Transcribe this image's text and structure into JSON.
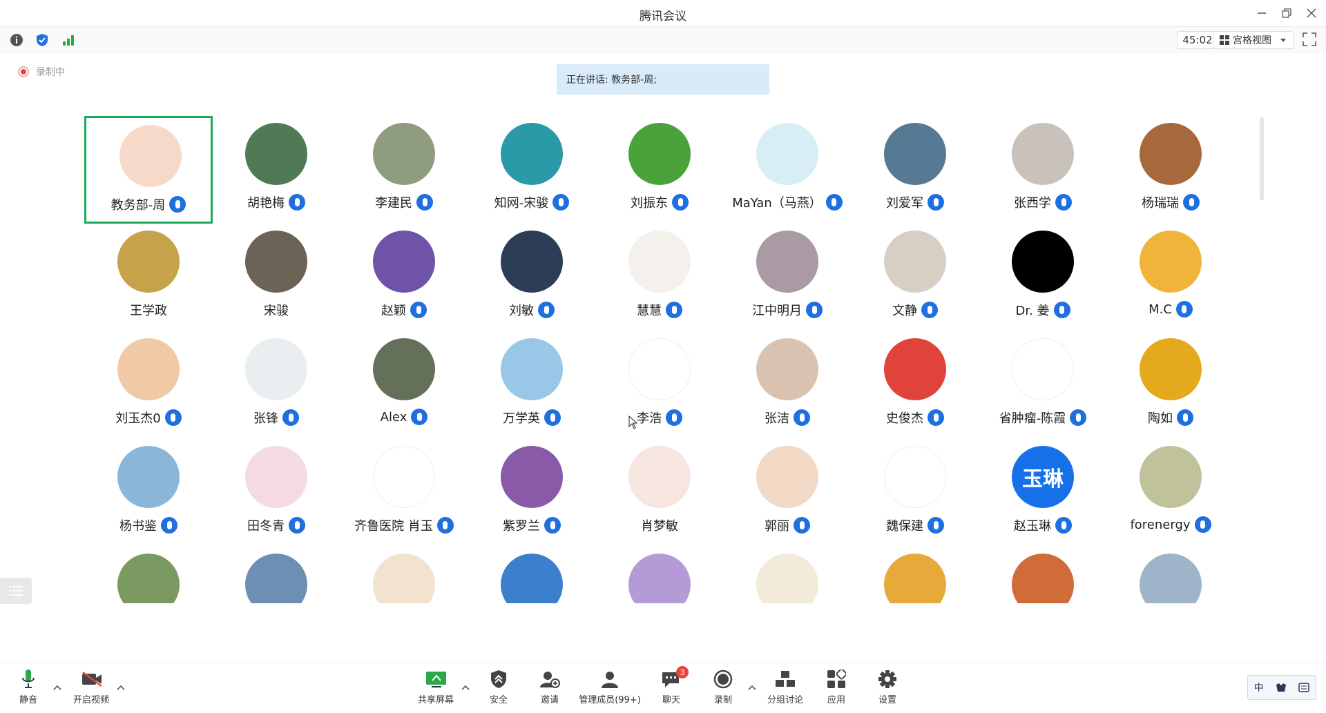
{
  "window": {
    "title": "腾讯会议"
  },
  "toolbar": {
    "timer": "45:02",
    "view_label": "宫格视图"
  },
  "status": {
    "recording_label": "录制中",
    "speaking": "正在讲话: 教务部-周;"
  },
  "colors": {
    "accent": "#1e6fe0",
    "active_border": "#1aaa5b",
    "recording": "#e8453c",
    "speaking_bg": "#d9eaf8"
  },
  "participants": [
    {
      "name": "教务部-周",
      "mic": true,
      "bg": "#f6d9c8",
      "active": true
    },
    {
      "name": "胡艳梅",
      "mic": true,
      "bg": "#4f7a55"
    },
    {
      "name": "李建民",
      "mic": true,
      "bg": "#8f9c7f"
    },
    {
      "name": "知网-宋骏",
      "mic": true,
      "bg": "#2a9aa8"
    },
    {
      "name": "刘振东",
      "mic": true,
      "bg": "#4aa33a"
    },
    {
      "name": "MaYan（马燕）",
      "mic": true,
      "bg": "#d7eef4"
    },
    {
      "name": "刘爱军",
      "mic": true,
      "bg": "#577a94"
    },
    {
      "name": "张西学",
      "mic": true,
      "bg": "#c9c2ba"
    },
    {
      "name": "杨瑞瑞",
      "mic": true,
      "bg": "#a7693c"
    },
    {
      "name": "王学政",
      "mic": false,
      "bg": "#c6a24a"
    },
    {
      "name": "宋骏",
      "mic": false,
      "bg": "#6d6256"
    },
    {
      "name": "赵颖",
      "mic": true,
      "bg": "#6e53a8"
    },
    {
      "name": "刘敏",
      "mic": true,
      "bg": "#2c3d55"
    },
    {
      "name": "慧慧",
      "mic": true,
      "bg": "#f4f1ec"
    },
    {
      "name": "江中明月",
      "mic": true,
      "bg": "#a99aa3"
    },
    {
      "name": "文静",
      "mic": true,
      "bg": "#d8cfc4"
    },
    {
      "name": "Dr. 姜",
      "mic": true,
      "bg": "#000000"
    },
    {
      "name": "M.C",
      "mic": true,
      "bg": "#f1b43b"
    },
    {
      "name": "刘玉杰0",
      "mic": true,
      "bg": "#f0c9a6"
    },
    {
      "name": "张锋",
      "mic": true,
      "bg": "#e9eef0"
    },
    {
      "name": "Alex",
      "mic": true,
      "bg": "#65705a"
    },
    {
      "name": "万学英",
      "mic": true,
      "bg": "#98c7e8"
    },
    {
      "name": "李浩",
      "mic": true,
      "bg": "#ffffff"
    },
    {
      "name": "张洁",
      "mic": true,
      "bg": "#d9c3b0"
    },
    {
      "name": "史俊杰",
      "mic": true,
      "bg": "#e0433a"
    },
    {
      "name": "省肿瘤-陈霞",
      "mic": true,
      "bg": "#ffffff"
    },
    {
      "name": "陶如",
      "mic": true,
      "bg": "#e4a91c"
    },
    {
      "name": "杨书鉴",
      "mic": true,
      "bg": "#8ab6d9"
    },
    {
      "name": "田冬青",
      "mic": true,
      "bg": "#f4dbe3"
    },
    {
      "name": "齐鲁医院 肖玉",
      "mic": true,
      "bg": "#ffffff"
    },
    {
      "name": "紫罗兰",
      "mic": true,
      "bg": "#8a5aa8"
    },
    {
      "name": "肖梦敏",
      "mic": false,
      "bg": "#f7e6df"
    },
    {
      "name": "郭丽",
      "mic": true,
      "bg": "#f2d9c6"
    },
    {
      "name": "魏保建",
      "mic": true,
      "bg": "#ffffff"
    },
    {
      "name": "赵玉琳",
      "mic": true,
      "bg": "#1670e8",
      "initials": "玉琳"
    },
    {
      "name": "forenergy",
      "mic": true,
      "bg": "#bfc29a"
    },
    {
      "name": "",
      "mic": false,
      "bg": "#7b9a62"
    },
    {
      "name": "",
      "mic": false,
      "bg": "#6d8fb3"
    },
    {
      "name": "",
      "mic": false,
      "bg": "#f3e2cf"
    },
    {
      "name": "",
      "mic": false,
      "bg": "#3c7fcc"
    },
    {
      "name": "",
      "mic": false,
      "bg": "#b49ad6"
    },
    {
      "name": "",
      "mic": false,
      "bg": "#f2ebd9"
    },
    {
      "name": "",
      "mic": false,
      "bg": "#e6a93a"
    },
    {
      "name": "",
      "mic": false,
      "bg": "#d06b3a"
    },
    {
      "name": "",
      "mic": false,
      "bg": "#9fb4c8"
    }
  ],
  "bottom": {
    "mute": "静音",
    "video": "开启视频",
    "share": "共享屏幕",
    "security": "安全",
    "invite": "邀请",
    "members": "管理成员(99+)",
    "chat": "聊天",
    "chat_badge": "3",
    "record": "录制",
    "breakout": "分组讨论",
    "apps": "应用",
    "settings": "设置"
  },
  "ime": {
    "mode": "中"
  }
}
